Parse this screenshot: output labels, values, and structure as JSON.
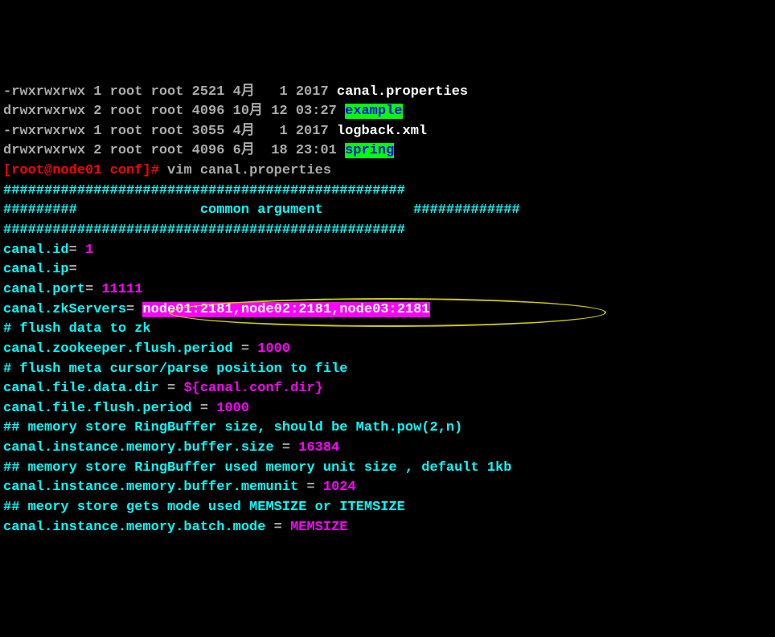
{
  "ls": {
    "row1": {
      "perm": "-rwxrwxrwx 1 root root 2521 4月   1 2017 ",
      "name": "canal.properties"
    },
    "row2": {
      "perm": "drwxrwxrwx 2 root root 4096 10月 12 03:27 ",
      "name": "example"
    },
    "row3": {
      "perm": "-rwxrwxrwx 1 root root 3055 4月   1 2017 ",
      "name": "logback.xml"
    },
    "row4": {
      "perm": "drwxrwxrwx 2 root root 4096 6月  18 23:01 ",
      "name": "spring"
    }
  },
  "prompt": {
    "ps1": "[root@node01 conf]# ",
    "cmd": "vim canal.properties"
  },
  "cfg": {
    "sep1": "#################################################",
    "sep2a": "#########",
    "sep2b": "common argument",
    "sep2c": "#############",
    "sep3": "#################################################",
    "id_key": "canal.id",
    "id_val": "1",
    "ip_key": "canal.ip",
    "port_key": "canal.port",
    "port_val": "11111",
    "zk_key": "canal.zkServers",
    "zk_val": "node01:2181,node02:2181,node03:2181",
    "flush_zk": "# flush data to zk",
    "zk_flush_key": "canal.zookeeper.flush.period",
    "zk_flush_val": "1000",
    "flush_meta": "# flush meta cursor/parse position to file",
    "file_dir_key": "canal.file.data.dir",
    "file_dir_val": "${canal.conf.dir}",
    "file_flush_key": "canal.file.flush.period",
    "file_flush_val": "1000",
    "mem_comment1": "## memory store RingBuffer size, should be Math.pow(2,n)",
    "mem_buf_key": "canal.instance.memory.buffer.size",
    "mem_buf_val": "16384",
    "mem_comment2": "## memory store RingBuffer used memory unit size , default 1kb",
    "mem_unit_key": "canal.instance.memory.buffer.memunit",
    "mem_unit_val": "1024",
    "mem_comment3": "## meory store gets mode used MEMSIZE or ITEMSIZE",
    "batch_key": "canal.instance.memory.batch.mode",
    "batch_val": "MEMSIZE"
  }
}
